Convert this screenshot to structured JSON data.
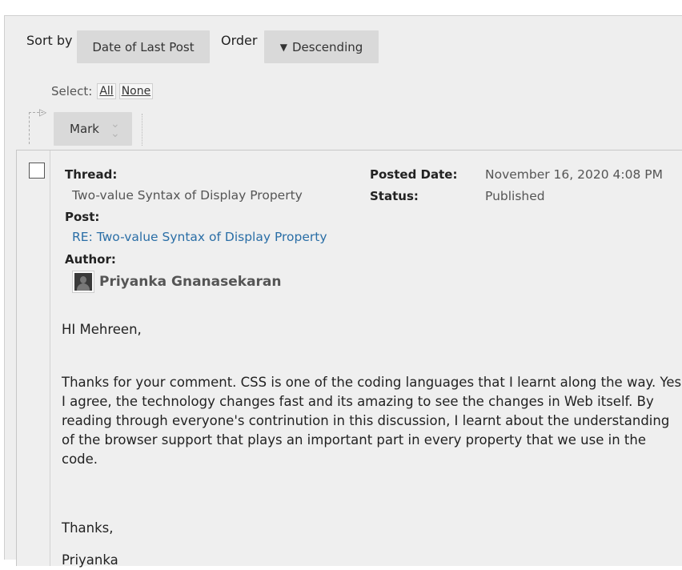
{
  "toolbar": {
    "sort_by_label": "Sort by",
    "sort_value": "Date of Last Post",
    "order_label": "Order",
    "order_value": "Descending",
    "order_icon": "triangle-down-icon"
  },
  "selection": {
    "label": "Select:",
    "all_label": "All",
    "none_label": "None"
  },
  "mark": {
    "label": "Mark",
    "icon": "double-chevron-down-icon"
  },
  "post": {
    "thread_label": "Thread:",
    "thread_value": "Two-value Syntax of Display Property",
    "post_label": "Post:",
    "post_value": "RE: Two-value Syntax of Display Property",
    "author_label": "Author:",
    "author_name": "Priyanka Gnanasekaran",
    "posted_date_label": "Posted Date:",
    "posted_date_value": "November 16, 2020 4:08 PM",
    "status_label": "Status:",
    "status_value": "Published",
    "body": {
      "greeting": "HI Mehreen,",
      "paragraph_lines": [
        "Thanks for your comment. CSS is one of the coding languages that I learnt along the way. Yes",
        "I agree, the technology changes fast and its amazing to see the changes in Web itself. By",
        "reading through everyone's contrinution in this discussion, I learnt about the understanding",
        "of the browser support that plays an important part in every property that we use in the",
        "code."
      ],
      "closing": "Thanks,",
      "signature": "Priyanka"
    }
  },
  "colors": {
    "background": "#eeeeee",
    "button": "#d9d9d9",
    "link": "#2a6ea6"
  }
}
